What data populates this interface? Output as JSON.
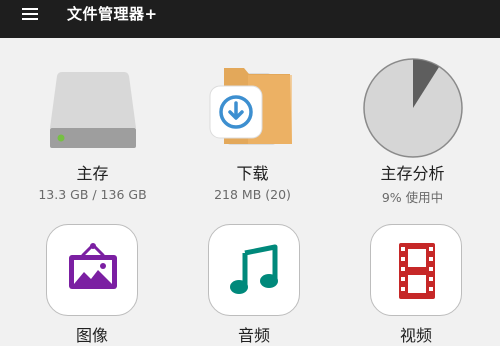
{
  "appbar": {
    "title": "文件管理器+",
    "menu_icon": "hamburger-menu-icon"
  },
  "tiles": [
    {
      "label": "主存",
      "sub": "13.3 GB / 136 GB",
      "icon": "drive-icon"
    },
    {
      "label": "下载",
      "sub": "218 MB (20)",
      "icon": "download-folder-icon"
    },
    {
      "label": "主存分析",
      "sub": "9% 使用中",
      "icon": "storage-pie-icon",
      "used_percent": 9
    },
    {
      "label": "图像",
      "icon": "image-icon",
      "color": "#7b1fa2"
    },
    {
      "label": "音频",
      "icon": "music-note-icon",
      "color": "#00897b"
    },
    {
      "label": "视频",
      "icon": "film-icon",
      "color": "#c62828"
    }
  ],
  "colors": {
    "appbar_bg": "#1e1e1e",
    "background": "#f1f1f1",
    "pie_used": "#5e5e5e",
    "pie_free": "#d6d6d6",
    "folder": "#e3a85a",
    "download_arrow": "#3d8fd0",
    "drive_led": "#76c043"
  }
}
